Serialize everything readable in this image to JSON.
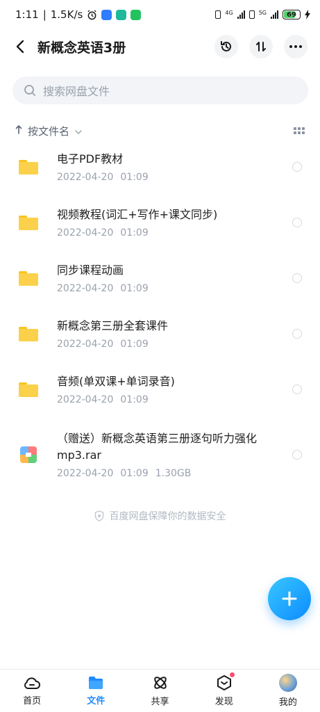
{
  "statusbar": {
    "time": "1:11",
    "speed": "1.5K/s",
    "battery": "69",
    "net1": "4G",
    "net2": "5G"
  },
  "header": {
    "title": "新概念英语3册",
    "icons": [
      "back-icon",
      "history-icon",
      "sort-transfer-icon",
      "more-icon"
    ]
  },
  "search": {
    "placeholder": "搜索网盘文件"
  },
  "sort": {
    "label": "按文件名"
  },
  "files": [
    {
      "name": "电子PDF教材",
      "date": "2022-04-20",
      "time": "01:09",
      "type": "folder"
    },
    {
      "name": "视频教程(词汇+写作+课文同步)",
      "date": "2022-04-20",
      "time": "01:09",
      "type": "folder"
    },
    {
      "name": "同步课程动画",
      "date": "2022-04-20",
      "time": "01:09",
      "type": "folder"
    },
    {
      "name": "新概念第三册全套课件",
      "date": "2022-04-20",
      "time": "01:09",
      "type": "folder"
    },
    {
      "name": "音频(单双课+单词录音)",
      "date": "2022-04-20",
      "time": "01:09",
      "type": "folder"
    },
    {
      "name": "（赠送）新概念英语第三册逐句听力强化mp3.rar",
      "date": "2022-04-20",
      "time": "01:09",
      "size": "1.30GB",
      "type": "rar"
    }
  ],
  "safety_note": "百度网盘保障你的数据安全",
  "nav": {
    "home": "首页",
    "files": "文件",
    "share": "共享",
    "discover": "发现",
    "me": "我的"
  },
  "colors": {
    "accent": "#1e8cff",
    "folder": "#fbd14b",
    "badge": "#ff4d6d"
  }
}
